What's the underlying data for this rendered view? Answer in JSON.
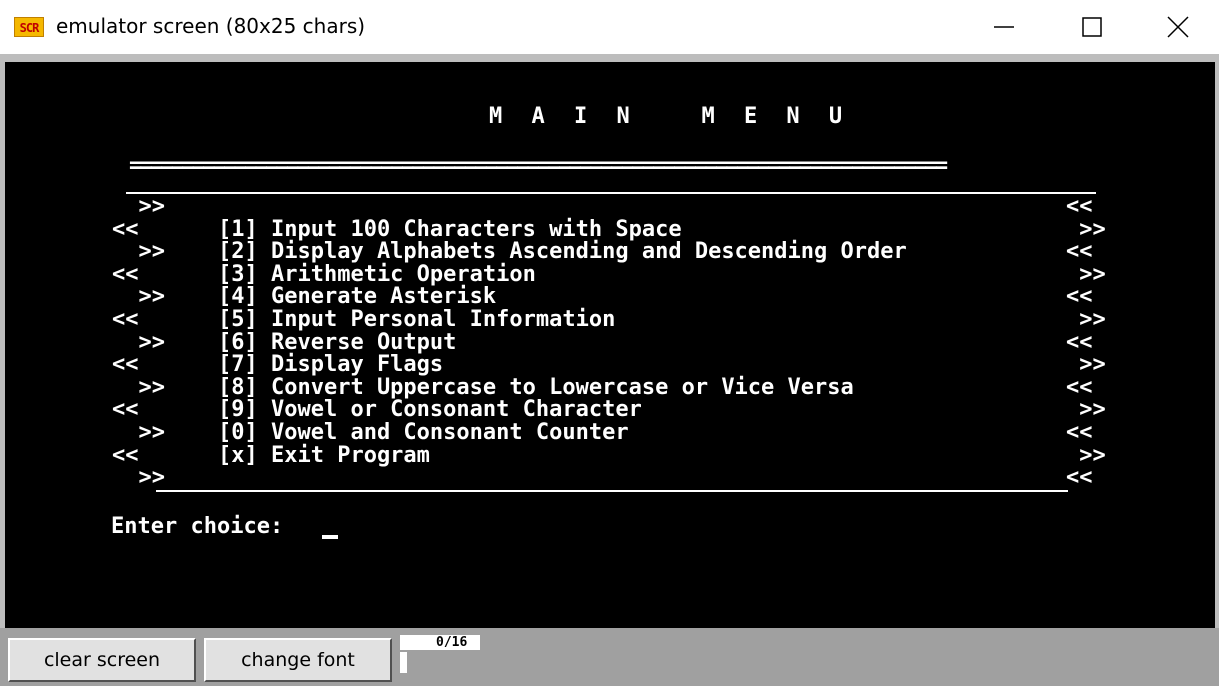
{
  "window": {
    "icon_label": "SCR",
    "title": "emulator screen (80x25 chars)"
  },
  "terminal": {
    "title": "M A I N   M E N U",
    "separator": "==============================================================================",
    "rows": [
      {
        "left": "  >>",
        "text": "",
        "right": "<<"
      },
      {
        "left": "<<",
        "text": "[1] Input 100 Characters with Space",
        "right": " >>"
      },
      {
        "left": "  >>",
        "text": "[2] Display Alphabets Ascending and Descending Order",
        "right": "<<"
      },
      {
        "left": "<<",
        "text": "[3] Arithmetic Operation",
        "right": " >>"
      },
      {
        "left": "  >>",
        "text": "[4] Generate Asterisk",
        "right": "<<"
      },
      {
        "left": "<<",
        "text": "[5] Input Personal Information",
        "right": " >>"
      },
      {
        "left": "  >>",
        "text": "[6] Reverse Output",
        "right": "<<"
      },
      {
        "left": "<<",
        "text": "[7] Display Flags",
        "right": " >>"
      },
      {
        "left": "  >>",
        "text": "[8] Convert Uppercase to Lowercase or Vice Versa",
        "right": "<<"
      },
      {
        "left": "<<",
        "text": "[9] Vowel or Consonant Character",
        "right": " >>"
      },
      {
        "left": "  >>",
        "text": "[0] Vowel and Consonant Counter",
        "right": "<<"
      },
      {
        "left": "<<",
        "text": "[x] Exit Program",
        "right": " >>"
      },
      {
        "left": "  >>",
        "text": "",
        "right": "<<"
      }
    ],
    "prompt": "Enter choice: "
  },
  "toolbar": {
    "clear_label": "clear screen",
    "font_label": "change font",
    "progress_text": "0/16",
    "progress_value": 0
  },
  "colors": {
    "screen_bg": "#000000",
    "screen_fg": "#ffffff",
    "icon_bg": "#f5b800",
    "icon_fg": "#c00000"
  }
}
